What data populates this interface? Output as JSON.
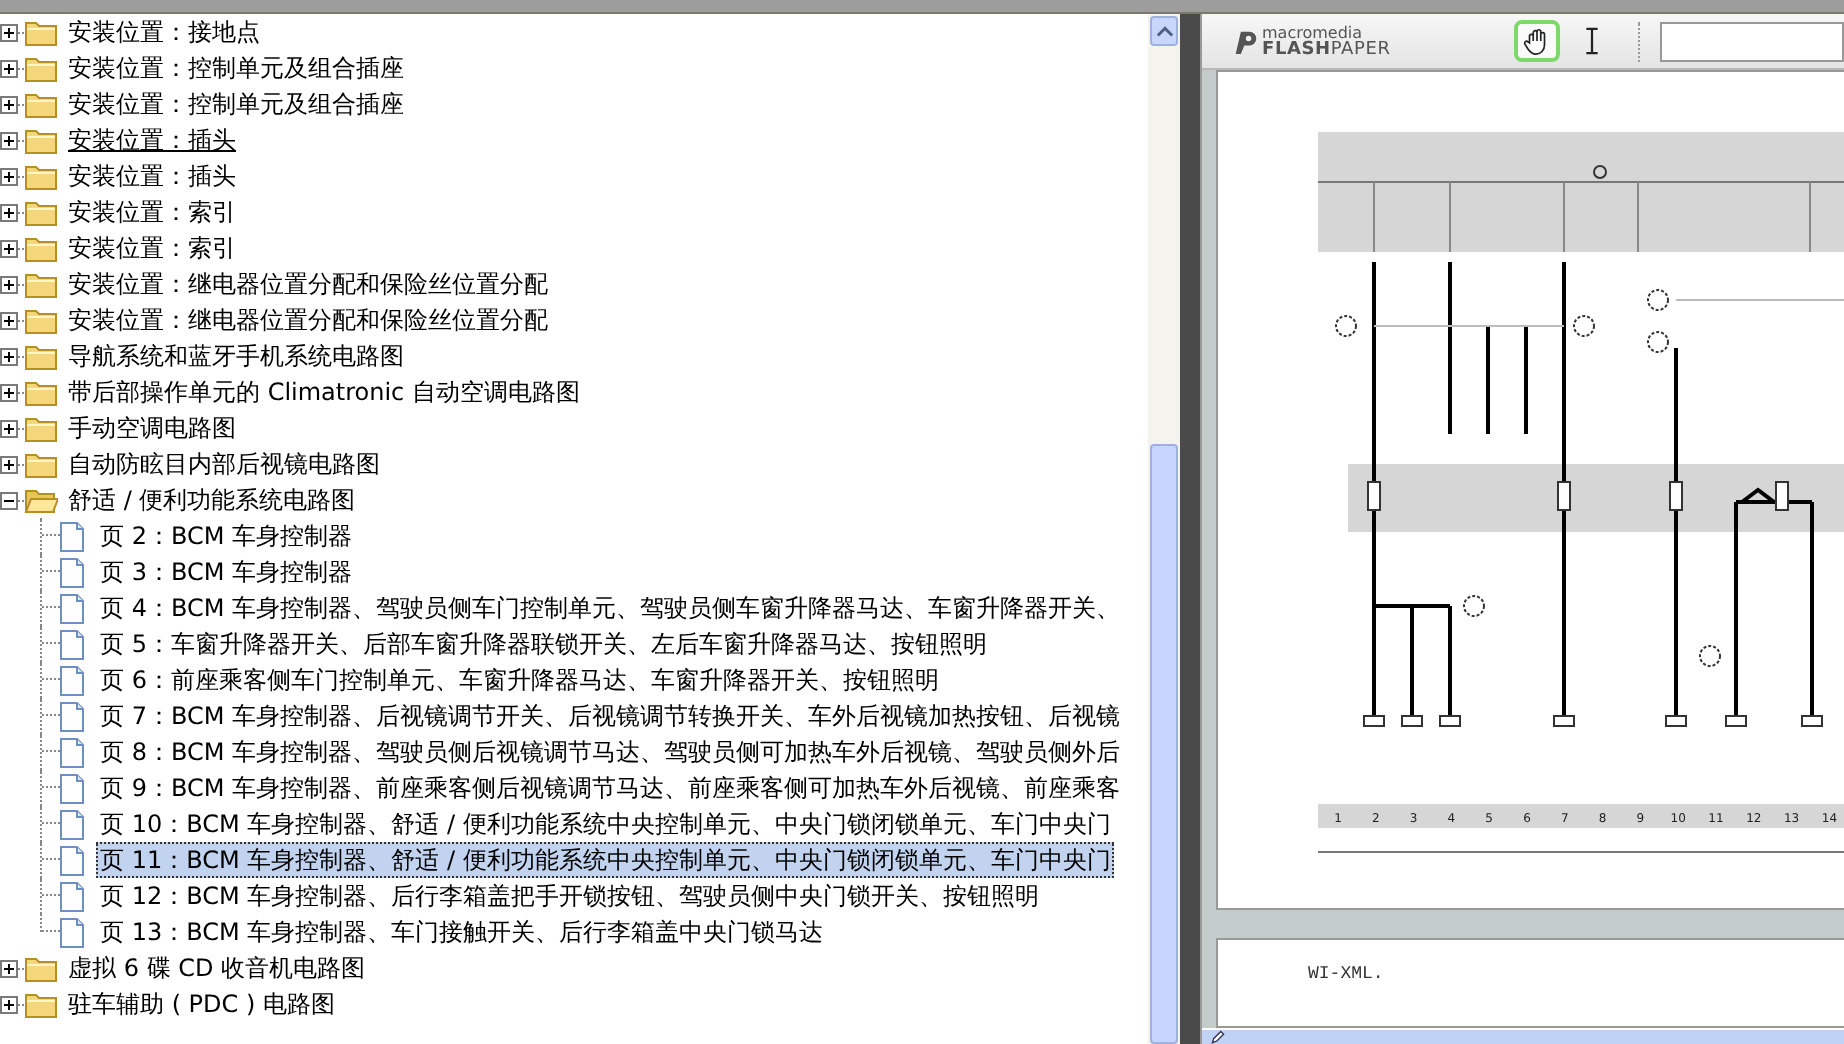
{
  "tree": {
    "items": [
      {
        "kind": "folder",
        "label": "安装位置：接地点",
        "expanded": false,
        "underlined": false,
        "selected": false
      },
      {
        "kind": "folder",
        "label": "安装位置：控制单元及组合插座",
        "expanded": false,
        "underlined": false,
        "selected": false
      },
      {
        "kind": "folder",
        "label": "安装位置：控制单元及组合插座",
        "expanded": false,
        "underlined": false,
        "selected": false
      },
      {
        "kind": "folder",
        "label": "安装位置：插头",
        "expanded": false,
        "underlined": true,
        "selected": false
      },
      {
        "kind": "folder",
        "label": "安装位置：插头",
        "expanded": false,
        "underlined": false,
        "selected": false
      },
      {
        "kind": "folder",
        "label": "安装位置：索引",
        "expanded": false,
        "underlined": false,
        "selected": false
      },
      {
        "kind": "folder",
        "label": "安装位置：索引",
        "expanded": false,
        "underlined": false,
        "selected": false
      },
      {
        "kind": "folder",
        "label": "安装位置：继电器位置分配和保险丝位置分配",
        "expanded": false,
        "underlined": false,
        "selected": false
      },
      {
        "kind": "folder",
        "label": "安装位置：继电器位置分配和保险丝位置分配",
        "expanded": false,
        "underlined": false,
        "selected": false
      },
      {
        "kind": "folder",
        "label": "导航系统和蓝牙手机系统电路图",
        "expanded": false,
        "underlined": false,
        "selected": false
      },
      {
        "kind": "folder",
        "label": "带后部操作单元的 Climatronic 自动空调电路图",
        "expanded": false,
        "underlined": false,
        "selected": false
      },
      {
        "kind": "folder",
        "label": "手动空调电路图",
        "expanded": false,
        "underlined": false,
        "selected": false
      },
      {
        "kind": "folder",
        "label": "自动防眩目内部后视镜电路图",
        "expanded": false,
        "underlined": false,
        "selected": false
      },
      {
        "kind": "folder",
        "label": "舒适 / 便利功能系统电路图",
        "expanded": true,
        "underlined": false,
        "selected": false,
        "children": [
          {
            "kind": "page",
            "label": "页 2：BCM 车身控制器",
            "underlined": false,
            "selected": false
          },
          {
            "kind": "page",
            "label": "页 3：BCM 车身控制器",
            "underlined": false,
            "selected": false
          },
          {
            "kind": "page",
            "label": "页 4：BCM 车身控制器、驾驶员侧车门控制单元、驾驶员侧车窗升降器马达、车窗升降器开关、",
            "underlined": false,
            "selected": false
          },
          {
            "kind": "page",
            "label": "页 5：车窗升降器开关、后部车窗升降器联锁开关、左后车窗升降器马达、按钮照明",
            "underlined": false,
            "selected": false
          },
          {
            "kind": "page",
            "label": "页 6：前座乘客侧车门控制单元、车窗升降器马达、车窗升降器开关、按钮照明",
            "underlined": false,
            "selected": false
          },
          {
            "kind": "page",
            "label": "页 7：BCM 车身控制器、后视镜调节开关、后视镜调节转换开关、车外后视镜加热按钮、后视镜",
            "underlined": false,
            "selected": false
          },
          {
            "kind": "page",
            "label": "页 8：BCM 车身控制器、驾驶员侧后视镜调节马达、驾驶员侧可加热车外后视镜、驾驶员侧外后",
            "underlined": false,
            "selected": false
          },
          {
            "kind": "page",
            "label": "页 9：BCM 车身控制器、前座乘客侧后视镜调节马达、前座乘客侧可加热车外后视镜、前座乘客",
            "underlined": false,
            "selected": false
          },
          {
            "kind": "page",
            "label": "页 10：BCM 车身控制器、舒适 / 便利功能系统中央控制单元、中央门锁闭锁单元、车门中央门",
            "underlined": false,
            "selected": false
          },
          {
            "kind": "page",
            "label": "页 11：BCM 车身控制器、舒适 / 便利功能系统中央控制单元、中央门锁闭锁单元、车门中央门",
            "underlined": false,
            "selected": true
          },
          {
            "kind": "page",
            "label": "页 12：BCM 车身控制器、后行李箱盖把手开锁按钮、驾驶员侧中央门锁开关、按钮照明",
            "underlined": false,
            "selected": false
          },
          {
            "kind": "page",
            "label": "页 13：BCM 车身控制器、车门接触开关、后行李箱盖中央门锁马达",
            "underlined": false,
            "selected": false
          }
        ]
      },
      {
        "kind": "folder",
        "label": "虚拟 6 碟 CD 收音机电路图",
        "expanded": false,
        "underlined": false,
        "selected": false
      },
      {
        "kind": "folder",
        "label": "驻车辅助 ( PDC ) 电路图",
        "expanded": false,
        "underlined": false,
        "selected": false
      }
    ]
  },
  "viewer": {
    "logo": {
      "brand": "macromedia",
      "product_bold": "FLASH",
      "product_rest": "PAPER"
    },
    "tools": [
      {
        "kind": "hand",
        "selected": true
      },
      {
        "kind": "text-select",
        "selected": false
      }
    ],
    "diagram": {
      "column_numbers": [
        "1",
        "2",
        "3",
        "4",
        "5",
        "6",
        "7",
        "8",
        "9",
        "10",
        "11",
        "12",
        "13",
        "14"
      ]
    },
    "next_page": {
      "text": "WI-XML."
    }
  }
}
